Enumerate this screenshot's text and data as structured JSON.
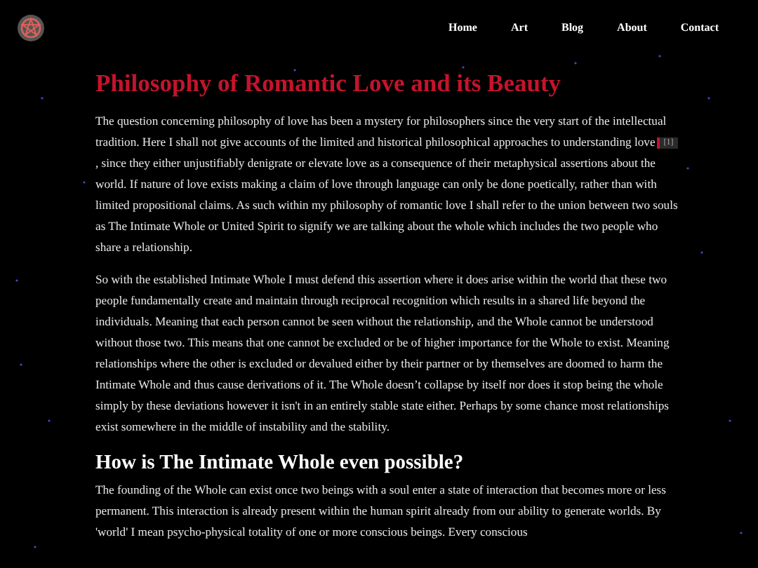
{
  "nav": {
    "items": [
      {
        "label": "Home"
      },
      {
        "label": "Art"
      },
      {
        "label": "Blog"
      },
      {
        "label": "About"
      },
      {
        "label": "Contact"
      }
    ]
  },
  "article": {
    "title": "Philosophy of Romantic Love and its Beauty",
    "blocks": [
      {
        "kind": "paragraph",
        "text": "The question concerning philosophy of love has been a mystery for philosophers since the very start of the intellectual tradition. Here I shall not give accounts of the limited and historical philosophical approaches to understanding love",
        "footnote": "[1]",
        "after": ", since they either unjustifiably denigrate or elevate love as a consequence of their metaphysical assertions about the world. If nature of love exists making a claim of love through language can only be done poetically, rather than with limited propositional claims. As such within my philosophy of romantic love I shall refer to the union between two souls as The Intimate Whole or United Spirit to signify we are talking about the whole which includes the two people who share a relationship."
      },
      {
        "kind": "paragraph",
        "text": "So with the established Intimate Whole I must defend this assertion where it does arise within the world that these two people fundamentally create and maintain through reciprocal recognition which results in a shared life beyond the individuals. Meaning that each person cannot be seen without the relationship, and the Whole cannot be understood without those two. This means that one cannot be excluded or be of higher importance for the Whole to exist. Meaning relationships where the other is excluded or devalued either by their partner or by themselves are doomed to harm the Intimate Whole and thus cause derivations of it. The Whole doesn’t collapse by itself nor does it stop being the whole simply by these deviations however it isn't in an entirely stable state either. Perhaps by some chance most relationships exist somewhere in the middle of instability and the stability."
      },
      {
        "kind": "heading",
        "text": "How is The Intimate Whole even possible?"
      },
      {
        "kind": "paragraph",
        "text": "The founding of the Whole can exist once two beings with a soul enter a state of interaction that becomes more or less permanent. This interaction is already present within the human spirit already from our ability to generate worlds. By 'world' I mean psycho-physical totality of one or more conscious beings. Every conscious"
      }
    ]
  }
}
